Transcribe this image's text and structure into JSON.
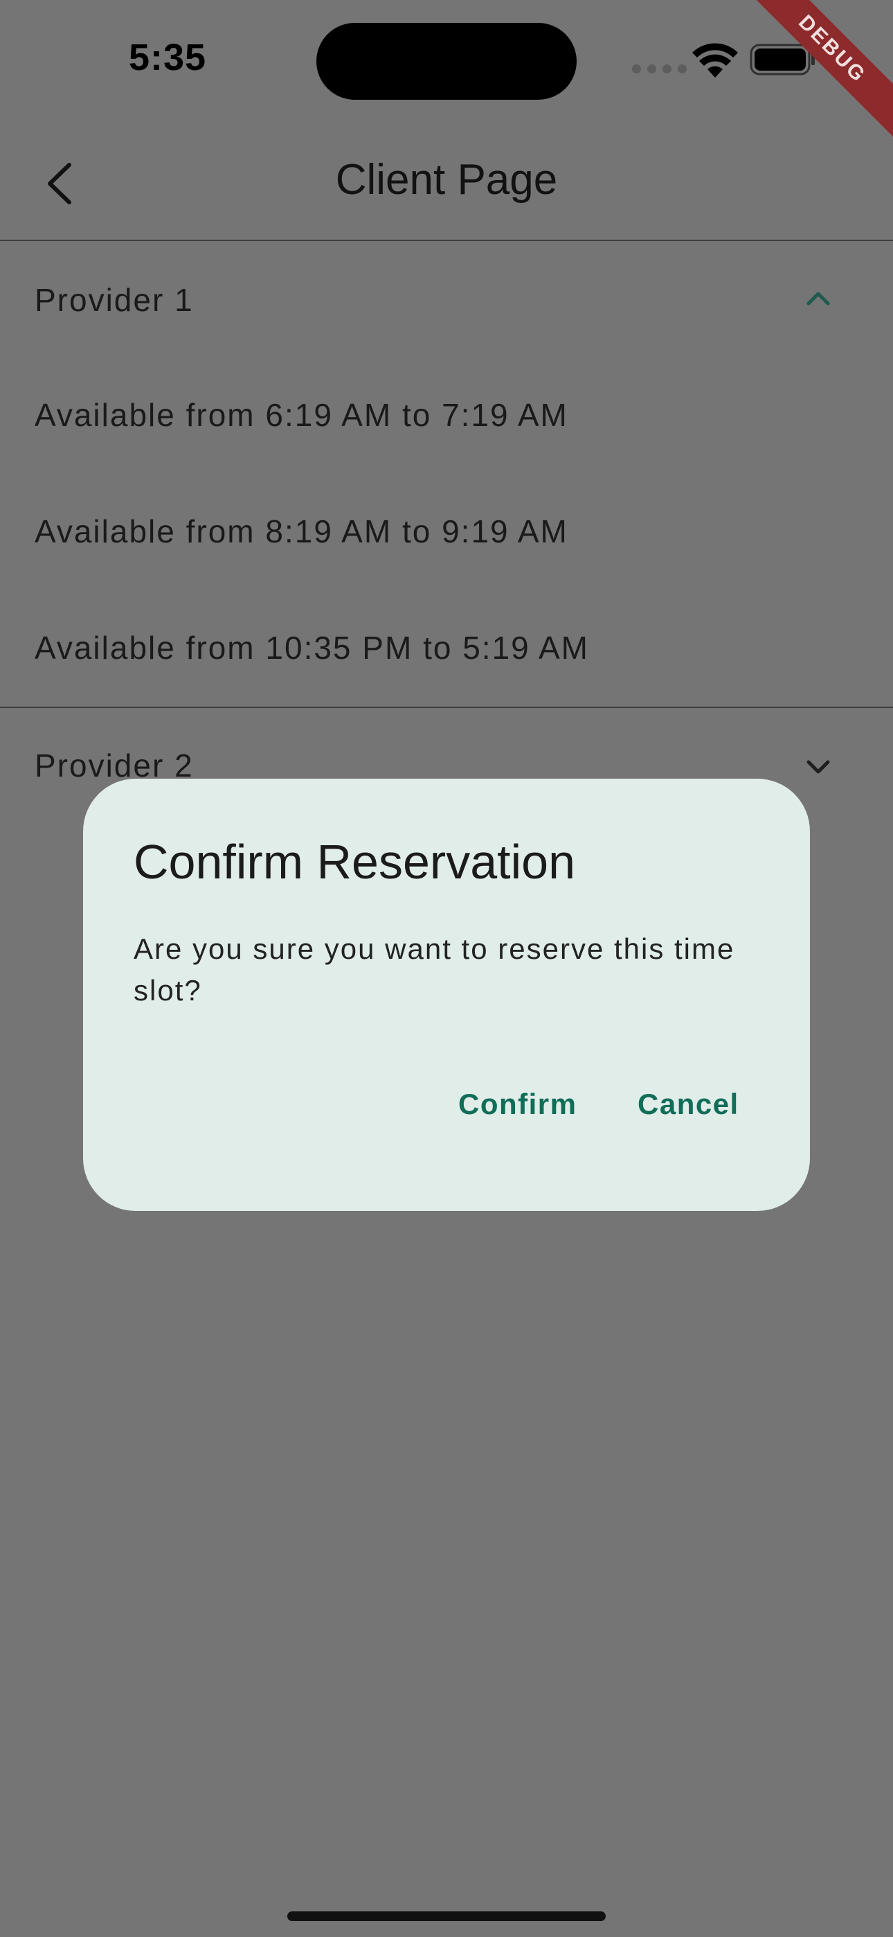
{
  "status_bar": {
    "time": "5:35"
  },
  "debug_banner": {
    "label": "DEBUG",
    "color": "#8c2a2c"
  },
  "app_bar": {
    "title": "Client Page",
    "back_icon": "chevron-left-icon"
  },
  "providers": [
    {
      "name": "Provider 1",
      "expanded": true,
      "chevron_icon": "chevron-up-icon",
      "slots": [
        "Available from 6:19 AM to 7:19 AM",
        "Available from 8:19 AM to 9:19 AM",
        "Available from 10:35 PM to 5:19 AM"
      ]
    },
    {
      "name": "Provider 2",
      "expanded": false,
      "chevron_icon": "chevron-down-icon",
      "slots": []
    }
  ],
  "dialog": {
    "title": "Confirm Reservation",
    "message": "Are you sure you want to reserve this time slot?",
    "confirm_label": "Confirm",
    "cancel_label": "Cancel",
    "background_color": "#e1ede8",
    "accent_color": "#106d58"
  },
  "scrim_color": "#757575"
}
